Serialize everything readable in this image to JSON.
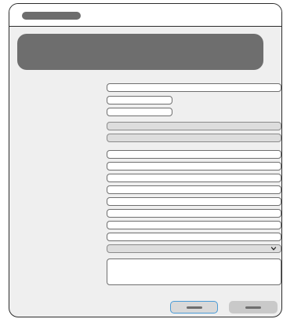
{
  "window": {
    "title": "",
    "header": ""
  },
  "form": {
    "fields": [
      {
        "value": ""
      },
      {
        "value": ""
      },
      {
        "value": ""
      },
      {
        "value": ""
      },
      {
        "value": ""
      },
      {
        "value": ""
      },
      {
        "value": ""
      },
      {
        "value": ""
      },
      {
        "value": ""
      },
      {
        "value": ""
      },
      {
        "value": ""
      },
      {
        "value": ""
      },
      {
        "value": ""
      }
    ],
    "select": {
      "value": ""
    },
    "notes": {
      "value": ""
    }
  },
  "buttons": {
    "primary_label": "",
    "secondary_label": ""
  },
  "colors": {
    "accent": "#4a9bd6",
    "title_placeholder": "#6d6d6d",
    "background": "#efefef"
  },
  "icons": {
    "select_arrow": "chevron-down-icon"
  }
}
